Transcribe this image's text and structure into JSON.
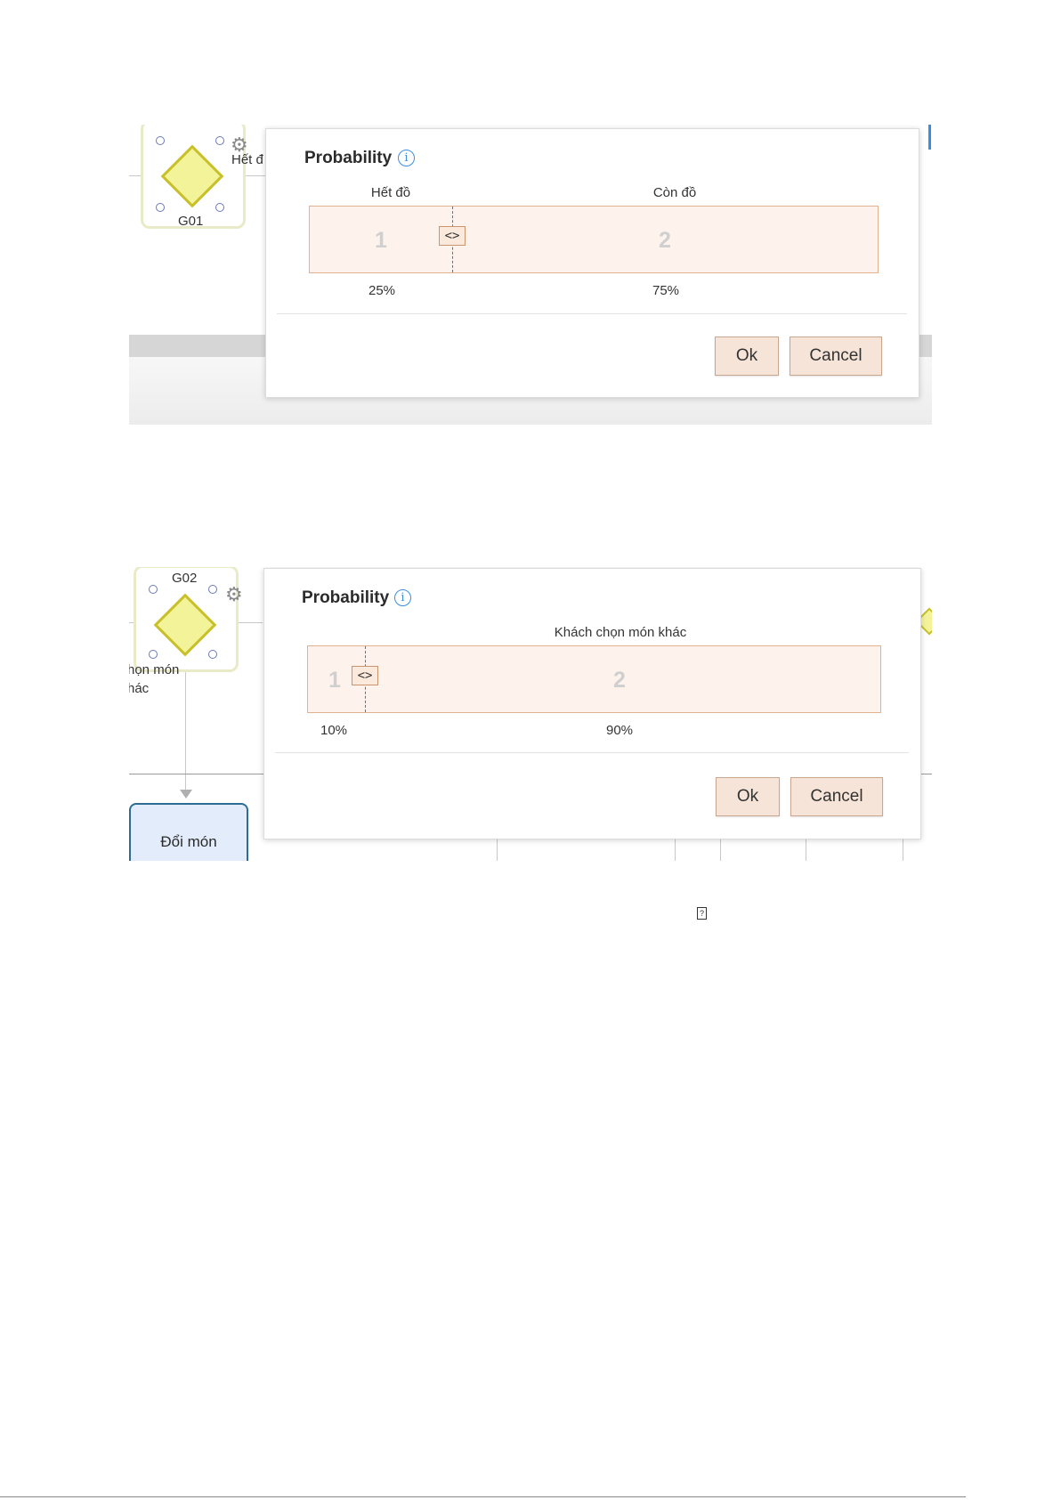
{
  "screenshot1": {
    "gateway": {
      "label": "G01",
      "partial_text": "Hết đ"
    },
    "dialog": {
      "title": "Probability",
      "segments": [
        {
          "number": "1",
          "label": "Hết đồ",
          "percent": "25%"
        },
        {
          "number": "2",
          "label": "Còn đồ",
          "percent": "75%"
        }
      ],
      "split_fraction": 0.25,
      "slider_glyph": "<>",
      "ok_label": "Ok",
      "cancel_label": "Cancel"
    }
  },
  "screenshot2": {
    "gateway": {
      "label": "G02"
    },
    "left_text_line1": "họn món",
    "left_text_line2": "hác",
    "task": {
      "label": "Đổi món"
    },
    "dialog": {
      "title": "Probability",
      "segments": [
        {
          "number": "1",
          "label": "",
          "percent": "10%"
        },
        {
          "number": "2",
          "label": "Khách chọn món khác",
          "percent": "90%"
        }
      ],
      "split_fraction": 0.1,
      "slider_glyph": "<>",
      "ok_label": "Ok",
      "cancel_label": "Cancel"
    }
  },
  "stray_glyph": "?",
  "colors": {
    "bar_fill": "#fdf3ec",
    "bar_border": "#e0b28f",
    "button_fill": "#f6e4d8",
    "gateway_fill": "#f3f39a",
    "info_blue": "#3b8ede"
  }
}
